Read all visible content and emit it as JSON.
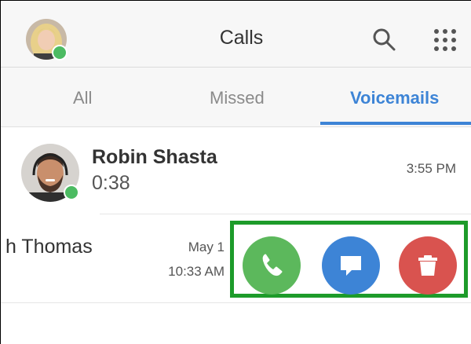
{
  "header": {
    "title": "Calls",
    "search_icon": "search-icon",
    "dialpad_icon": "dialpad-icon"
  },
  "tabs": [
    {
      "label": "All",
      "active": false
    },
    {
      "label": "Missed",
      "active": false
    },
    {
      "label": "Voicemails",
      "active": true
    }
  ],
  "voicemails": [
    {
      "name": "Robin Shasta",
      "duration": "0:38",
      "time": "3:55 PM",
      "online": true
    },
    {
      "name": "h Thomas",
      "date": "May 1",
      "time": "10:33 AM"
    }
  ],
  "actions": {
    "call_icon": "phone-icon",
    "message_icon": "message-icon",
    "delete_icon": "trash-icon"
  },
  "colors": {
    "accent": "#3d84d6",
    "call": "#5cb85c",
    "message": "#3d84d6",
    "delete": "#d9534f",
    "presence": "#4cbb62",
    "highlight_border": "#1d9b2a"
  }
}
